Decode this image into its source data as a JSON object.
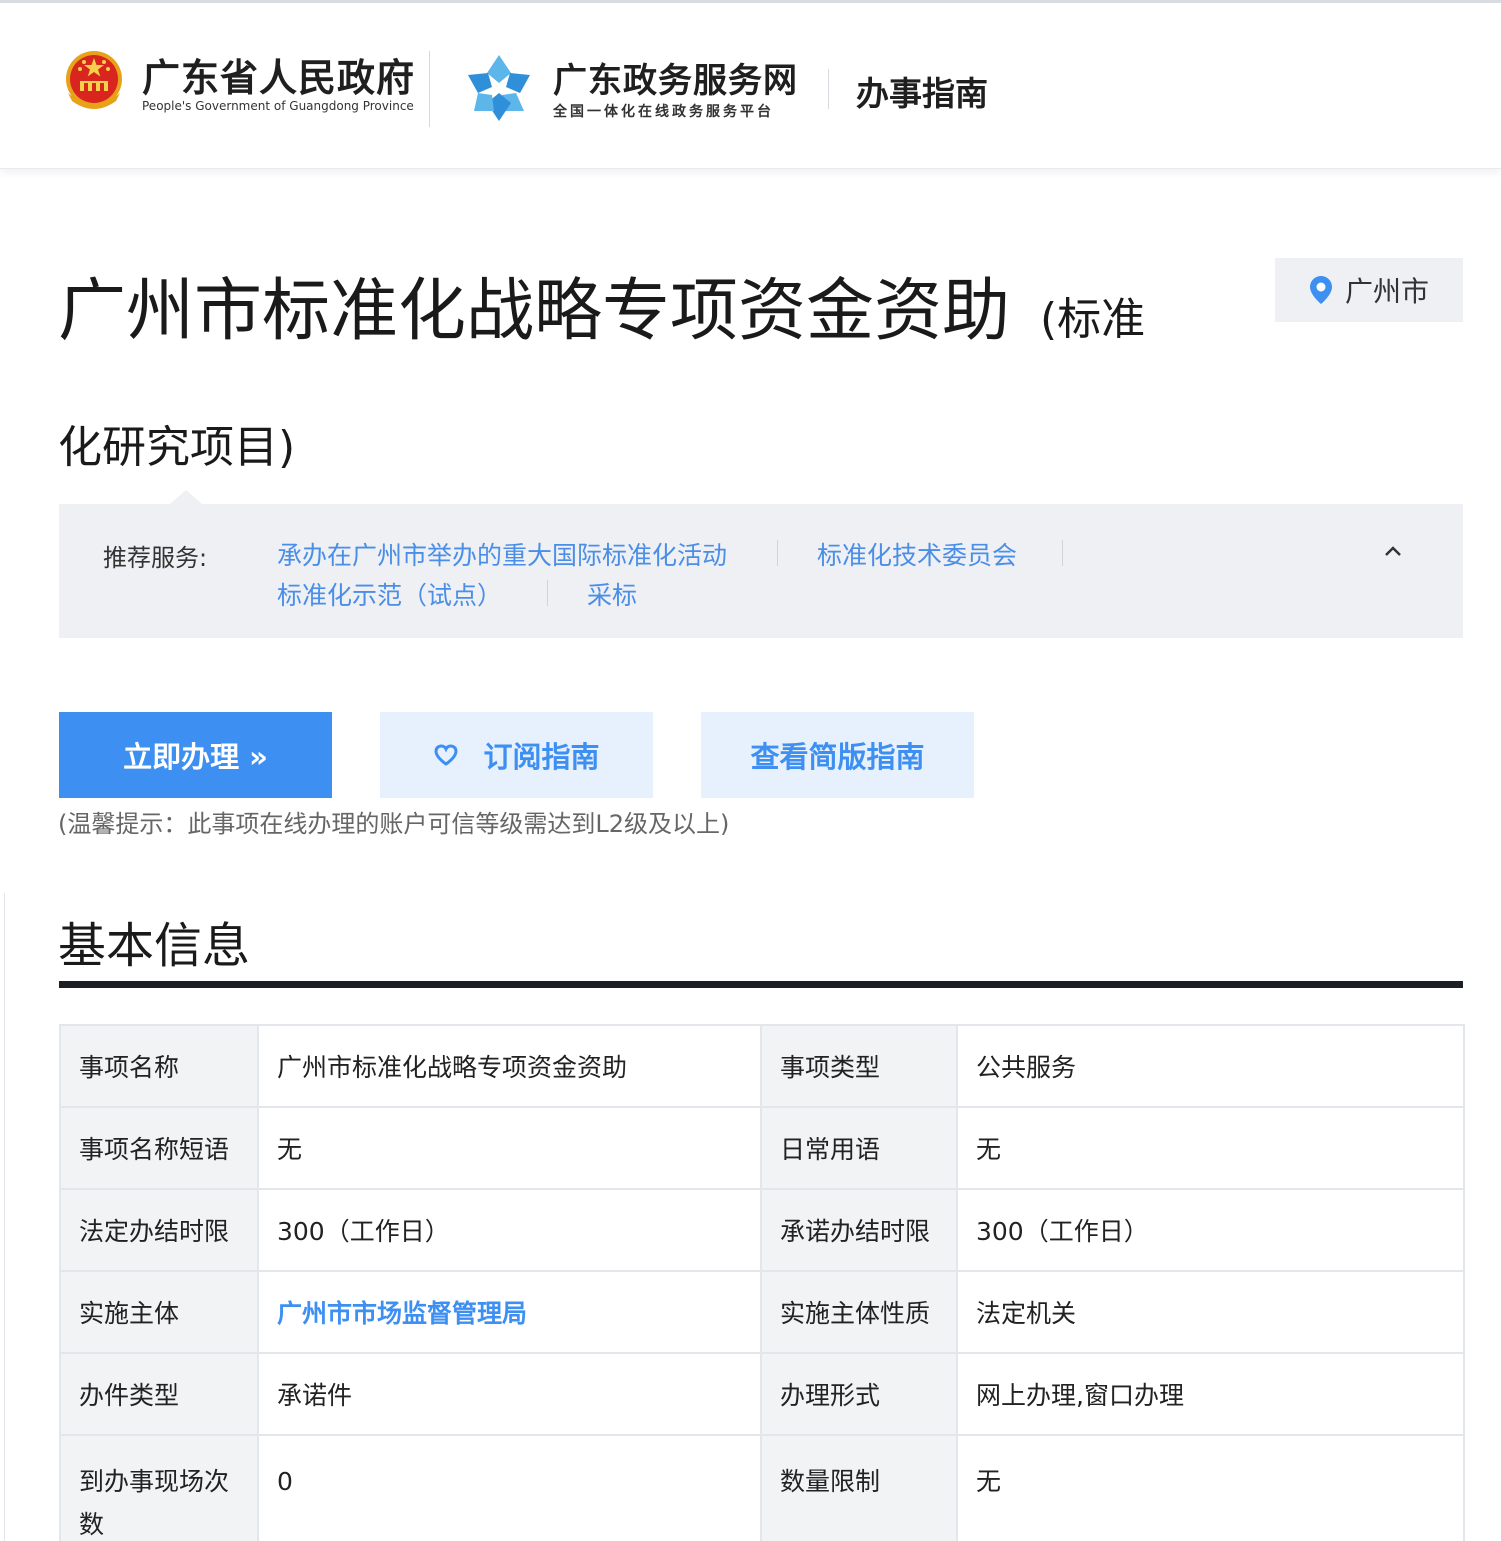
{
  "header": {
    "gov_title": "广东省人民政府",
    "gov_subtitle": "People's Government of Guangdong Province",
    "service_title": "广东政务服务网",
    "service_subtitle": "全国一体化在线政务服务平台",
    "section": "办事指南"
  },
  "title": {
    "main": "广州市标准化战略专项资金资助",
    "suffix": "(标准化研究项目)"
  },
  "location": {
    "label": "广州市",
    "icon": "location-pin-icon"
  },
  "recommend": {
    "label": "推荐服务:",
    "links": [
      "承办在广州市举办的重大国际标准化活动",
      "标准化技术委员会",
      "标准化示范（试点）",
      "采标"
    ]
  },
  "actions": {
    "apply": "立即办理 »",
    "subscribe": "订阅指南",
    "simple": "查看简版指南",
    "tip": "(温馨提示：此事项在线办理的账户可信等级需达到L2级及以上)"
  },
  "basic_info": {
    "title": "基本信息",
    "rows": [
      {
        "k1": "事项名称",
        "v1": "广州市标准化战略专项资金资助",
        "k2": "事项类型",
        "v2": "公共服务"
      },
      {
        "k1": "事项名称短语",
        "v1": "无",
        "k2": "日常用语",
        "v2": "无"
      },
      {
        "k1": "法定办结时限",
        "v1": "300（工作日）",
        "k2": "承诺办结时限",
        "v2": "300（工作日）"
      },
      {
        "k1": "实施主体",
        "v1": "广州市市场监督管理局",
        "k2": "实施主体性质",
        "v2": "法定机关"
      },
      {
        "k1": "办件类型",
        "v1": "承诺件",
        "k2": "办理形式",
        "v2": "网上办理,窗口办理"
      },
      {
        "k1": "到办事现场次数",
        "v1": "0",
        "k2": "数量限制",
        "v2": "无"
      }
    ]
  },
  "colors": {
    "primary": "#3d8ff2",
    "link": "#4a8ee8",
    "panel_bg": "#eef0f3"
  }
}
